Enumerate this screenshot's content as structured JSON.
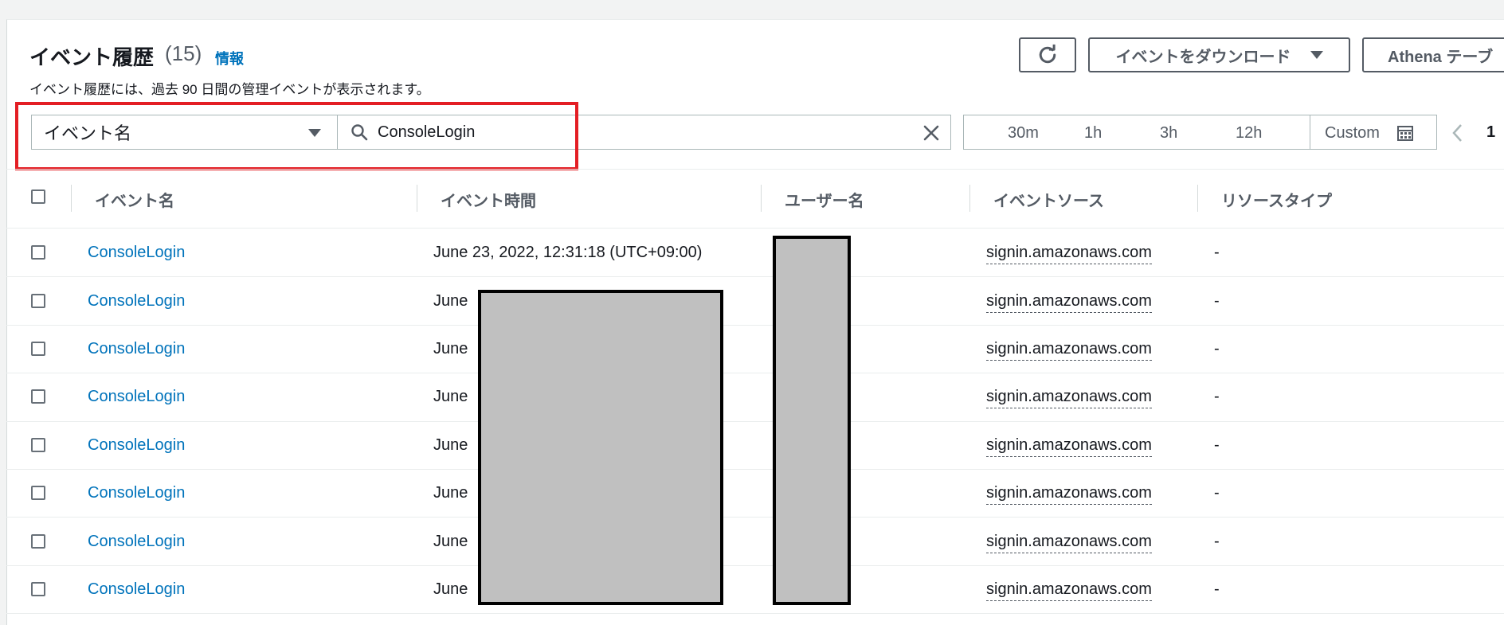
{
  "header": {
    "title": "イベント履歴",
    "count": "(15)",
    "info_link": "情報",
    "description": "イベント履歴には、過去 90 日間の管理イベントが表示されます。"
  },
  "actions": {
    "refresh_icon": "refresh-icon",
    "download_label": "イベントをダウンロード",
    "athena_label": "Athena テーブ"
  },
  "filter": {
    "attribute_selected": "イベント名",
    "search_value": "ConsoleLogin",
    "search_icon": "search-icon",
    "clear_icon": "close-icon"
  },
  "time_range": {
    "options": [
      "30m",
      "1h",
      "3h",
      "12h"
    ],
    "custom_label": "Custom",
    "custom_icon": "calendar-icon"
  },
  "pagination": {
    "prev_icon": "chevron-left-icon",
    "current_page": "1"
  },
  "table": {
    "columns": [
      "イベント名",
      "イベント時間",
      "ユーザー名",
      "イベントソース",
      "リソースタイプ"
    ],
    "rows": [
      {
        "event_name": "ConsoleLogin",
        "event_time": "June 23, 2022, 12:31:18 (UTC+09:00)",
        "event_source": "signin.amazonaws.com",
        "resource_type": "-"
      },
      {
        "event_name": "ConsoleLogin",
        "event_time": "June",
        "event_source": "signin.amazonaws.com",
        "resource_type": "-"
      },
      {
        "event_name": "ConsoleLogin",
        "event_time": "June",
        "event_source": "signin.amazonaws.com",
        "resource_type": "-"
      },
      {
        "event_name": "ConsoleLogin",
        "event_time": "June",
        "event_source": "signin.amazonaws.com",
        "resource_type": "-"
      },
      {
        "event_name": "ConsoleLogin",
        "event_time": "June",
        "event_source": "signin.amazonaws.com",
        "resource_type": "-"
      },
      {
        "event_name": "ConsoleLogin",
        "event_time": "June",
        "event_source": "signin.amazonaws.com",
        "resource_type": "-"
      },
      {
        "event_name": "ConsoleLogin",
        "event_time": "June",
        "event_source": "signin.amazonaws.com",
        "resource_type": "-"
      },
      {
        "event_name": "ConsoleLogin",
        "event_time": "June",
        "event_source": "signin.amazonaws.com",
        "resource_type": "-"
      }
    ]
  },
  "colors": {
    "link": "#0073bb",
    "highlight_box": "#e31e24",
    "redaction_fill": "#c0c0c0"
  }
}
